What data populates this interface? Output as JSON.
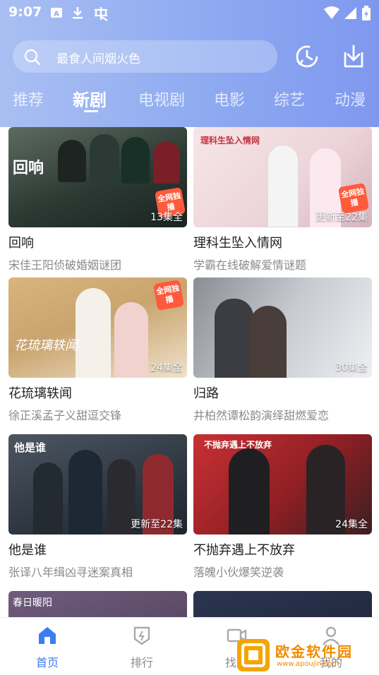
{
  "status_bar": {
    "time": "9:07"
  },
  "search": {
    "placeholder": "最食人间烟火色"
  },
  "tabs": [
    {
      "label": "推荐"
    },
    {
      "label": "新剧",
      "active": true
    },
    {
      "label": "电视剧"
    },
    {
      "label": "电影"
    },
    {
      "label": "综艺"
    },
    {
      "label": "动漫"
    }
  ],
  "cards": [
    {
      "title": "回响",
      "desc": "宋佳王阳侦破婚姻谜团",
      "badge": "13集全",
      "thumb_text": "回响",
      "exclusive": "全网独播",
      "colors": [
        "#2c3a34",
        "#6b7466"
      ]
    },
    {
      "title": "理科生坠入情网",
      "desc": "学霸在线破解爱情谜题",
      "badge": "更新至22集",
      "thumb_text": "理科生坠入情网",
      "exclusive": "全网独播",
      "colors": [
        "#f3dfe1",
        "#c9a8b3"
      ]
    },
    {
      "title": "花琉璃轶闻",
      "desc": "徐正溪孟子义甜逗交锋",
      "badge": "24集全",
      "thumb_text": "花琉璃轶闻",
      "exclusive": "全网独播",
      "colors": [
        "#c9a46e",
        "#e8d6b8"
      ]
    },
    {
      "title": "归路",
      "desc": "井柏然谭松韵演绎甜燃爱恋",
      "badge": "30集全",
      "colors": [
        "#6a6d74",
        "#dcdfe4"
      ]
    },
    {
      "title": "他是谁",
      "desc": "张译八年缉凶寻迷案真相",
      "badge": "更新至22集",
      "thumb_text": "他是谁",
      "colors": [
        "#2e3640",
        "#6f7a86"
      ]
    },
    {
      "title": "不抛弃遇上不放弃",
      "desc": "落魄小伙爆笑逆袭",
      "badge": "24集全",
      "thumb_text": "不抛弃遇上不放弃",
      "colors": [
        "#b2282a",
        "#3a1f22"
      ]
    },
    {
      "title": "",
      "desc": "",
      "badge": "",
      "thumb_text": "春日暖阳",
      "colors": [
        "#4a3a55",
        "#8c7a96"
      ]
    },
    {
      "title": "",
      "desc": "",
      "badge": "",
      "colors": [
        "#1a2233",
        "#3a4660"
      ]
    }
  ],
  "bottom_nav": [
    {
      "label": "首页",
      "icon": "home-icon",
      "active": true
    },
    {
      "label": "排行",
      "icon": "ranking-icon"
    },
    {
      "label": "找片",
      "icon": "video-icon"
    },
    {
      "label": "我的",
      "icon": "profile-icon"
    }
  ],
  "watermark": {
    "text": "欧金软件园",
    "sub": "www.apoujin.com"
  },
  "colors": {
    "accent": "#3b7cf0",
    "header_left": "#a9bff3",
    "header_right": "#7f98ef"
  }
}
